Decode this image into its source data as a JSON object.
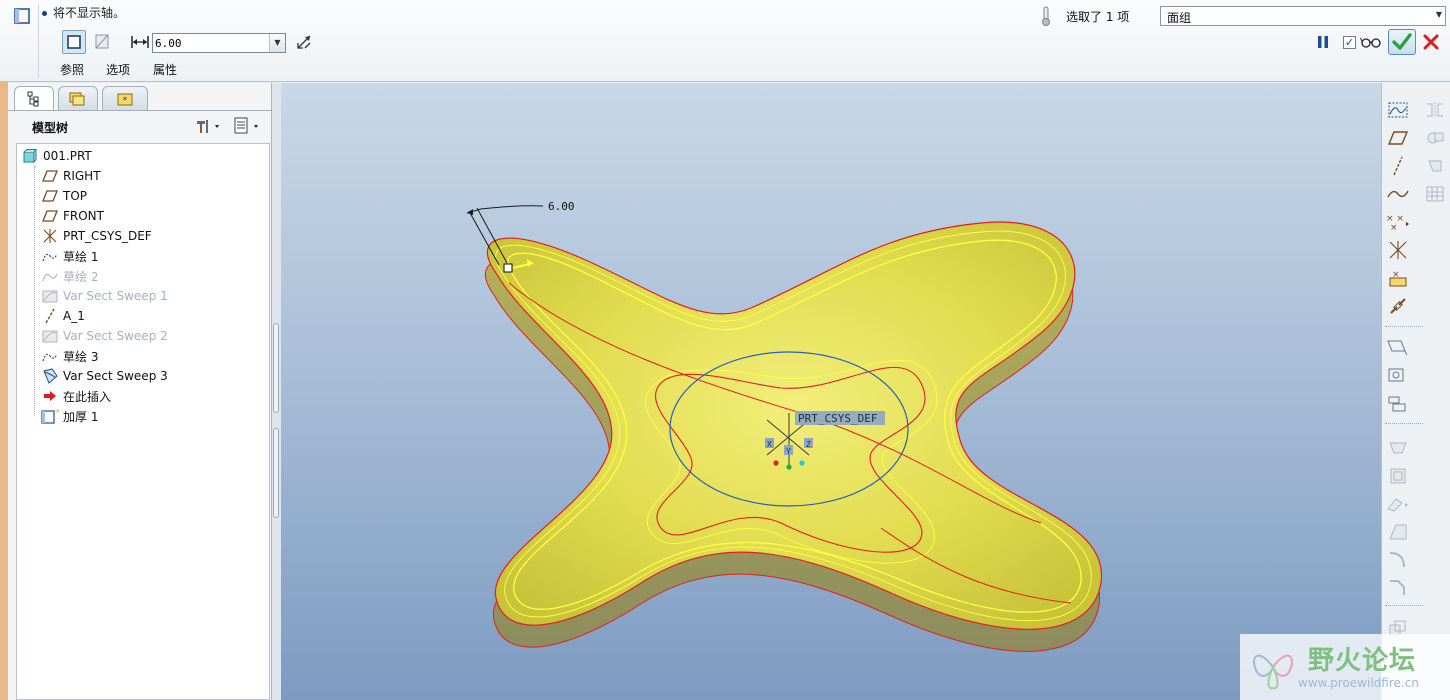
{
  "dashboard": {
    "message": "将不显示轴。",
    "thickness_value": "6.00",
    "tabs": [
      {
        "label": "参照"
      },
      {
        "label": "选项"
      },
      {
        "label": "属性"
      }
    ],
    "selection_status": "选取了 1 项",
    "filter_value": "面组",
    "preview_checked": true,
    "icons": [
      "thicken-feature-icon",
      "solid-thicken-icon",
      "surface-thicken-icon",
      "thickness-dimension-icon",
      "flip-direction-icon",
      "thermometer-icon",
      "pause-icon",
      "glasses-icon",
      "checkmark-icon",
      "close-icon"
    ]
  },
  "navigator": {
    "tree_title": "模型树",
    "tree_items": [
      {
        "label": "001.PRT",
        "icon": "part-icon",
        "suppressed": false
      },
      {
        "label": "RIGHT",
        "icon": "datum-plane-icon",
        "suppressed": false
      },
      {
        "label": "TOP",
        "icon": "datum-plane-icon",
        "suppressed": false
      },
      {
        "label": "FRONT",
        "icon": "datum-plane-icon",
        "suppressed": false
      },
      {
        "label": "PRT_CSYS_DEF",
        "icon": "csys-icon",
        "suppressed": false
      },
      {
        "label": "草绘 1",
        "icon": "sketch-icon",
        "suppressed": false
      },
      {
        "label": "草绘 2",
        "icon": "sketch-icon",
        "suppressed": true
      },
      {
        "label": "Var Sect Sweep 1",
        "icon": "sweep-icon",
        "suppressed": true
      },
      {
        "label": "A_1",
        "icon": "datum-axis-icon",
        "suppressed": false
      },
      {
        "label": "Var Sect Sweep 2",
        "icon": "sweep-icon",
        "suppressed": true
      },
      {
        "label": "草绘 3",
        "icon": "sketch-icon",
        "suppressed": false
      },
      {
        "label": "Var Sect Sweep 3",
        "icon": "sweep-icon",
        "suppressed": false
      },
      {
        "label": "在此插入",
        "icon": "insert-here-arrow-icon",
        "suppressed": false
      },
      {
        "label": "加厚 1",
        "icon": "thicken-feature-icon",
        "suppressed": false
      }
    ]
  },
  "graphics": {
    "dimension_label": "6.00",
    "csys_label": "PRT_CSYS_DEF",
    "axis_labels": [
      "X",
      "Y",
      "Z"
    ]
  },
  "watermark": {
    "text": "野火论坛",
    "url": "www.proewildfire.cn"
  },
  "colors": {
    "accent": "#1d63b4",
    "part_fill": "#e6e35a",
    "edge_red": "#e02020",
    "edge_yellow": "#ffff40",
    "ok_green": "#24a340",
    "cancel_red": "#d91f1f"
  }
}
